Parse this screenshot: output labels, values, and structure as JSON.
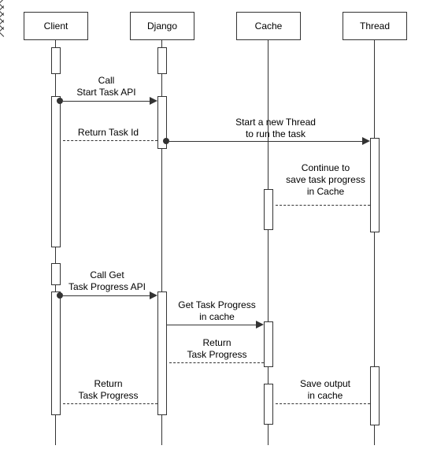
{
  "actors": {
    "client": "Client",
    "django": "Django",
    "cache": "Cache",
    "thread": "Thread"
  },
  "messages": {
    "call_start": "Call\nStart Task API",
    "return_task_id": "Return Task Id",
    "start_thread": "Start a new Thread\nto run the task",
    "continue_save": "Continue to\nsave task progress\nin Cache",
    "call_get": "Call Get\nTask Progress API",
    "get_progress": "Get Task Progress\nin cache",
    "return_progress_1": "Return\nTask Progress",
    "return_progress_2": "Return\nTask Progress",
    "save_output": "Save output\nin cache"
  },
  "chart_data": {
    "type": "sequence-diagram",
    "actors": [
      "Client",
      "Django",
      "Cache",
      "Thread"
    ],
    "interactions": [
      {
        "from": "Client",
        "to": "Django",
        "label": "Call Start Task API",
        "kind": "sync"
      },
      {
        "from": "Django",
        "to": "Client",
        "label": "Return Task Id",
        "kind": "return"
      },
      {
        "from": "Django",
        "to": "Thread",
        "label": "Start a new Thread to run the task",
        "kind": "sync"
      },
      {
        "from": "Thread",
        "to": "Cache",
        "label": "Continue to save task progress in Cache",
        "kind": "return"
      },
      {
        "from": "Client",
        "to": "Django",
        "label": "Call Get Task Progress API",
        "kind": "sync"
      },
      {
        "from": "Django",
        "to": "Cache",
        "label": "Get Task Progress in cache",
        "kind": "sync"
      },
      {
        "from": "Cache",
        "to": "Django",
        "label": "Return Task Progress",
        "kind": "return"
      },
      {
        "from": "Django",
        "to": "Client",
        "label": "Return Task Progress",
        "kind": "return"
      },
      {
        "from": "Thread",
        "to": "Cache",
        "label": "Save output in cache",
        "kind": "return"
      }
    ]
  }
}
